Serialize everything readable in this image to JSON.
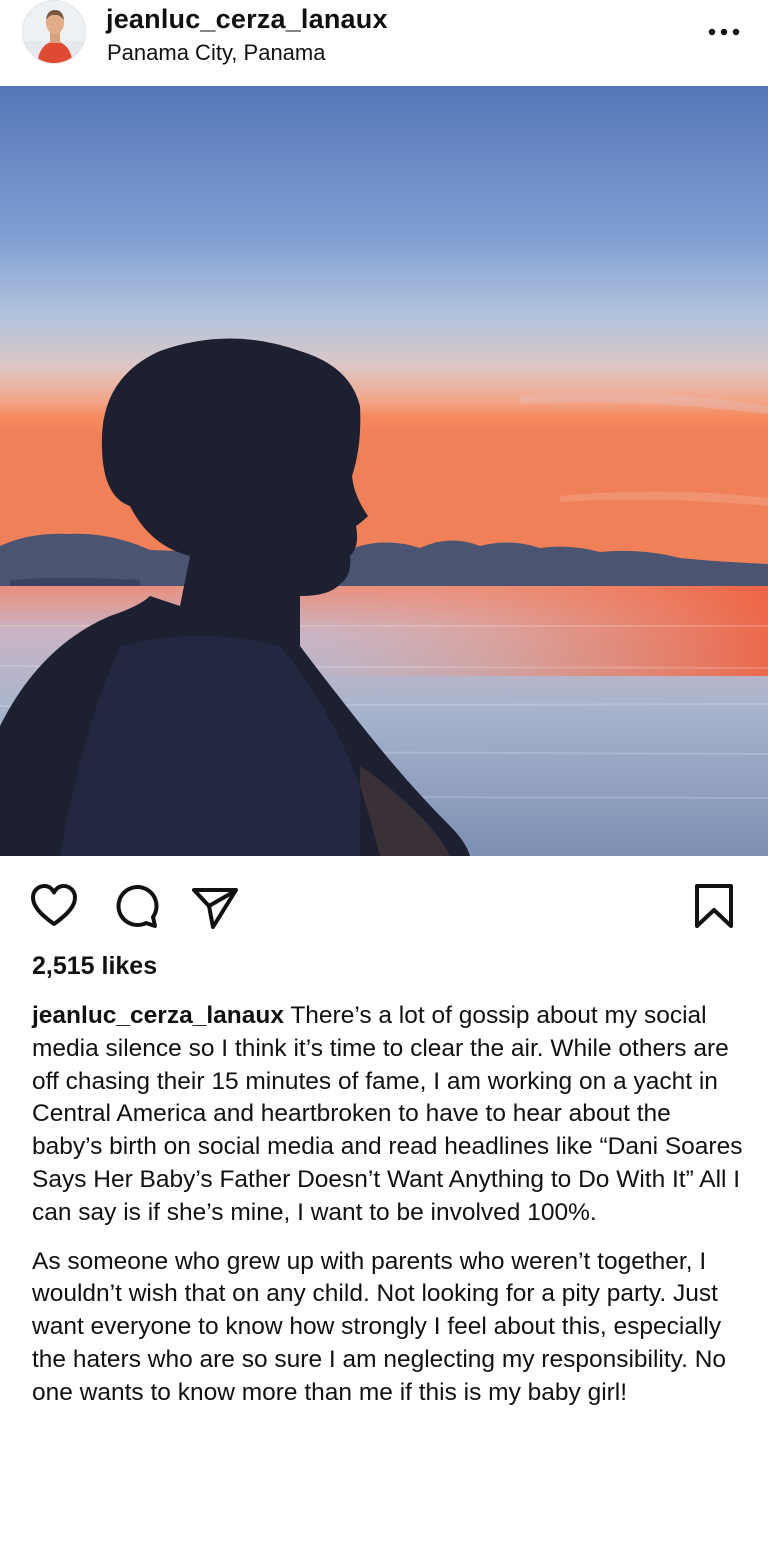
{
  "post": {
    "username": "jeanluc_cerza_lanaux",
    "location": "Panama City, Panama",
    "likes_text": "2,515 likes",
    "caption_username": "jeanluc_cerza_lanaux",
    "caption_paragraph_1": " There’s a lot of gossip about my social media silence so I think it’s time to clear the air. While others are off chasing their 15 minutes of fame, I am working on a yacht in Central America and heartbroken to have to hear about the baby’s birth on social media and read headlines like “Dani Soares Says Her Baby’s Father Doesn’t Want Anything to Do With It” All I can say is if she’s mine, I want to be involved 100%.",
    "caption_paragraph_2": "As someone who grew up with parents who weren’t together, I wouldn’t wish that on any child. Not looking for a pity party. Just want everyone to know how strongly I feel about this, especially the haters who are so sure I am neglecting my responsibility. No one wants to know more than me if this is my baby girl!"
  },
  "icons": {
    "more": "more-options-icon",
    "like": "heart-icon",
    "comment": "comment-icon",
    "share": "send-icon",
    "save": "bookmark-icon"
  },
  "colors": {
    "text": "#111111",
    "sky_top": "#5d86c4",
    "sunset": "#f07a4e",
    "water": "#9aa8c2"
  }
}
